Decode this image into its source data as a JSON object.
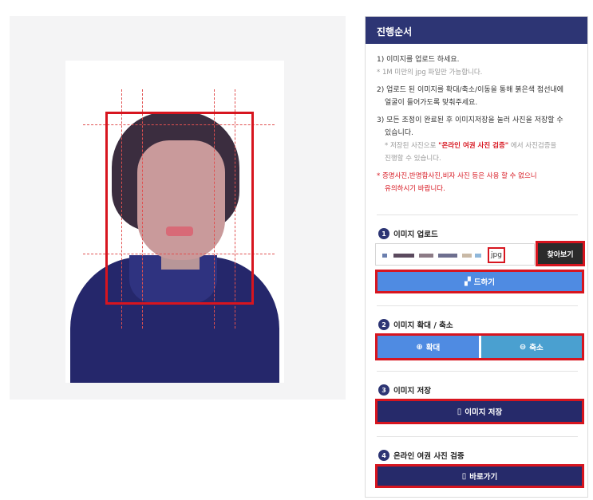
{
  "panel": {
    "title": "진행순서",
    "step1": "1) 이미지를 업로드 하세요.",
    "step1_note": "* 1M 미만의 jpg 파일만 가능합니다.",
    "step2_line1": "2) 업로드 된 이미지를 확대/축소/이동을 통해 붉은색 점선내에",
    "step2_line2": "얼굴이 들어가도록 맞춰주세요.",
    "step3_line1": "3) 모든 조정이 완료된 후 이미지저장을 눌러 사진을 저장할 수",
    "step3_line2": "있습니다.",
    "step3_note_a": "* 저장된 사진으로 ",
    "step3_note_hl": "\"온라인 여권 사진 검증\"",
    "step3_note_b": " 에서 사진검증을",
    "step3_note_line2": "진행할 수 있습니다.",
    "warning_line1": "* 증명사진,반명함사진,비자 사진 등은 사용 할 수 없으니",
    "warning_line2": "유의하시기 바랍니다."
  },
  "sections": {
    "upload": {
      "num": "1",
      "title": "이미지 업로드",
      "file_ext": "jpg",
      "browse_label": "찾아보기",
      "upload_label": "드하기"
    },
    "zoom": {
      "num": "2",
      "title": "이미지 확대 / 축소",
      "zoom_in_label": "확대",
      "zoom_out_label": "축소"
    },
    "save": {
      "num": "3",
      "title": "이미지 저장",
      "save_label": "이미지 저장"
    },
    "verify": {
      "num": "4",
      "title": "온라인 여권 사진 검증",
      "go_label": "바로가기"
    }
  },
  "icons": {
    "zoom_in": "zoom-in-icon",
    "zoom_out": "zoom-out-icon",
    "document": "document-icon"
  },
  "colors": {
    "header": "#2d3574",
    "highlight_red": "#d7151f",
    "button_blue": "#4f8be2",
    "button_teal": "#4aa0d0",
    "button_navy": "#262a6a",
    "browse_dark": "#2b2b2b"
  }
}
